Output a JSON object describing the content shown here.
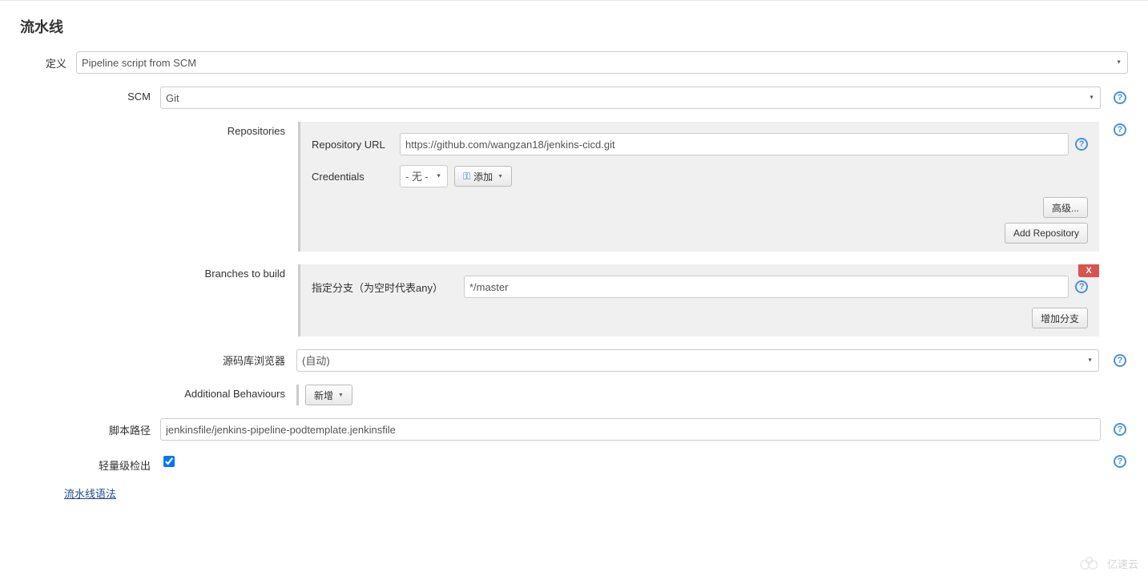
{
  "section_title": "流水线",
  "definition": {
    "label": "定义",
    "value": "Pipeline script from SCM"
  },
  "scm": {
    "label": "SCM",
    "value": "Git"
  },
  "repositories": {
    "label": "Repositories",
    "repo_url_label": "Repository URL",
    "repo_url_value": "https://github.com/wangzan18/jenkins-cicd.git",
    "credentials_label": "Credentials",
    "credentials_value": "- 无 -",
    "add_btn": "添加",
    "advanced_btn": "高级...",
    "add_repo_btn": "Add Repository"
  },
  "branches": {
    "label": "Branches to build",
    "branch_spec_label": "指定分支（为空时代表any）",
    "branch_spec_value": "*/master",
    "add_branch_btn": "增加分支",
    "delete_badge": "X"
  },
  "repo_browser": {
    "label": "源码库浏览器",
    "value": "(自动)"
  },
  "additional_behaviours": {
    "label": "Additional Behaviours",
    "add_btn": "新增"
  },
  "script_path": {
    "label": "脚本路径",
    "value": "jenkinsfile/jenkins-pipeline-podtemplate.jenkinsfile"
  },
  "lightweight": {
    "label": "轻量级检出",
    "checked": true
  },
  "pipeline_syntax_link": "流水线语法",
  "watermark": "亿速云"
}
